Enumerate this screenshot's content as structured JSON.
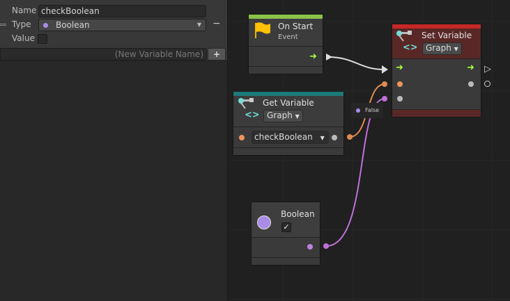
{
  "inspector": {
    "name_label": "Name",
    "name_value": "checkBoolean",
    "type_label": "Type",
    "type_value": "Boolean",
    "value_label": "Value",
    "value_checked": false,
    "new_var_placeholder": "(New Variable Name)",
    "add_label": "+",
    "remove_label": "−"
  },
  "nodes": {
    "on_start": {
      "title": "On Start",
      "subtitle": "Event",
      "color": "#8bc34a"
    },
    "set_variable": {
      "title": "Set Variable",
      "scope": "Graph",
      "color": "#c62828"
    },
    "get_variable": {
      "title": "Get Variable",
      "scope": "Graph",
      "variable": "checkBoolean",
      "color": "#1e7a7a"
    },
    "boolean": {
      "title": "Boolean",
      "checked": true
    }
  },
  "tooltip": {
    "value": "False"
  },
  "colors": {
    "flow": "#a8ff3e",
    "string_port": "#f0945a",
    "bool_port": "#c080e0",
    "boolean_type": "#a98ce8"
  }
}
